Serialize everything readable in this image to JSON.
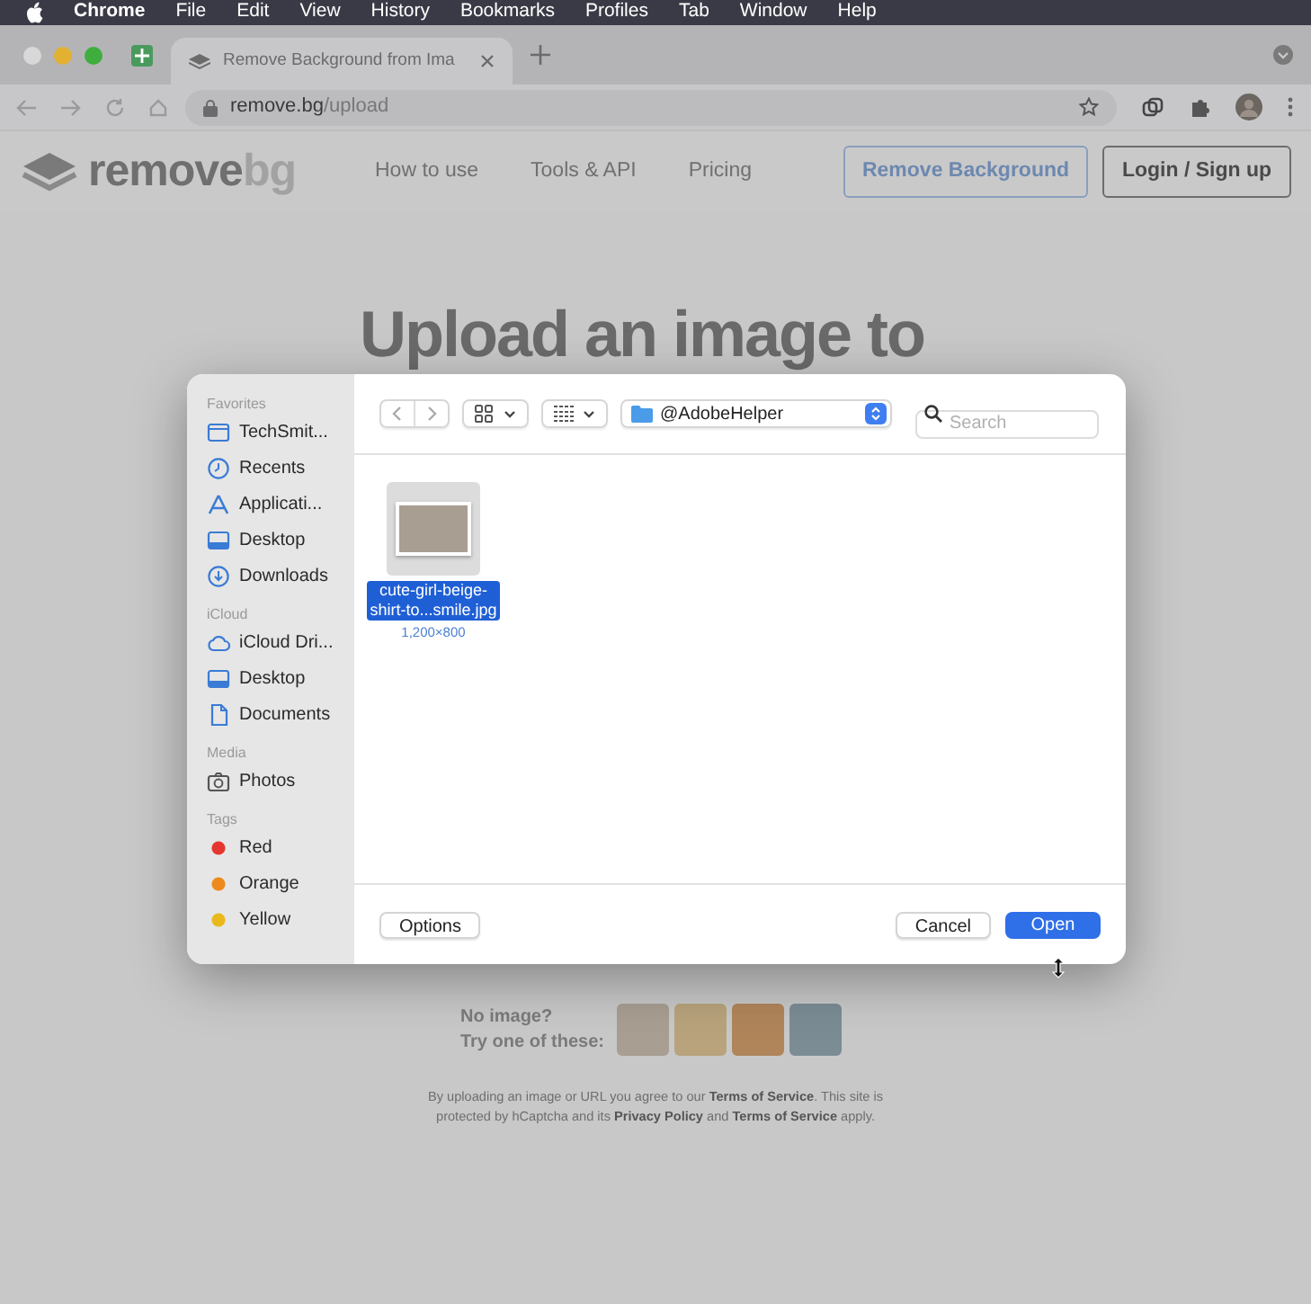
{
  "menu_bar": {
    "app": "Chrome",
    "items": [
      "File",
      "Edit",
      "View",
      "History",
      "Bookmarks",
      "Profiles",
      "Tab",
      "Window",
      "Help"
    ]
  },
  "browser": {
    "tab_title": "Remove Background from Ima",
    "url_host": "remove.bg",
    "url_path": "/upload"
  },
  "site_header": {
    "logo": {
      "part_1": "remove",
      "part_2": "bg"
    },
    "nav": [
      "How to use",
      "Tools & API",
      "Pricing"
    ],
    "buttons": [
      {
        "label": "Remove Background",
        "kind": "outline-accent"
      },
      {
        "label": "Login / Sign up",
        "kind": "outline"
      }
    ]
  },
  "page": {
    "heading": "Upload an image to",
    "samples_label_1": "No image?",
    "samples_label_2": "Try one of these:",
    "legal": "By uploading an image or URL you agree to our **Terms of Service**. This site is protected by hCaptcha and its **Privacy Policy** and **Terms of Service** apply."
  },
  "dialog": {
    "sidebar": [
      {
        "title": "Favorites",
        "items": [
          {
            "label": "TechSmit...",
            "kind": "folder"
          },
          {
            "label": "Recents",
            "kind": "clock"
          },
          {
            "label": "Applicati...",
            "kind": "apps"
          },
          {
            "label": "Desktop",
            "kind": "desktop"
          },
          {
            "label": "Downloads",
            "kind": "download"
          }
        ]
      },
      {
        "title": "iCloud",
        "items": [
          {
            "label": "iCloud Dri...",
            "kind": "cloud"
          },
          {
            "label": "Desktop",
            "kind": "desktop"
          },
          {
            "label": "Documents",
            "kind": "document"
          }
        ]
      },
      {
        "title": "Media",
        "items": [
          {
            "label": "Photos",
            "kind": "camera"
          }
        ]
      },
      {
        "title": "Tags",
        "items": [
          {
            "label": "Red",
            "kind": "tag",
            "color": "#e5372f"
          },
          {
            "label": "Orange",
            "kind": "tag",
            "color": "#ee8a1c"
          },
          {
            "label": "Yellow",
            "kind": "tag",
            "color": "#e9b91c"
          }
        ]
      }
    ],
    "location": "@AdobeHelper",
    "search": {
      "placeholder": "Search"
    },
    "files": [
      {
        "name_lines": [
          "cute-girl-beige-",
          "shirt-to...smile.jpg"
        ],
        "dimensions": "1,200×800",
        "selected": true
      }
    ],
    "buttons": [
      {
        "label": "Options",
        "kind": "plain"
      },
      {
        "label": "Cancel",
        "kind": "plain"
      },
      {
        "label": "Open",
        "kind": "default"
      }
    ]
  }
}
